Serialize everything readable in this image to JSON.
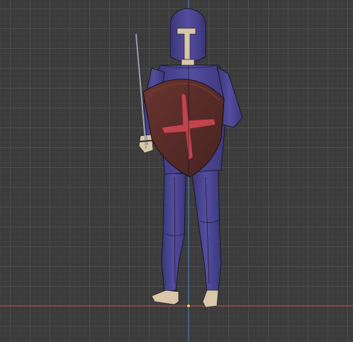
{
  "viewport": {
    "background_color": "#3b3b3b",
    "grid_major_color": "#4e4e4e",
    "grid_minor_color": "#424242",
    "axis_x_color": "#c84a4a",
    "axis_z_color": "#4a7ec8",
    "origin_color": "#f0c060"
  },
  "model": {
    "armor_color": "#4b4591",
    "armor_shadow_color": "#2f2b66",
    "skin_color": "#d8c7a8",
    "shield_color": "#5b2f2a",
    "shield_emblem_color": "#c1444c",
    "sword_color": "#8b8f98",
    "wireframe_color": "#101018"
  }
}
